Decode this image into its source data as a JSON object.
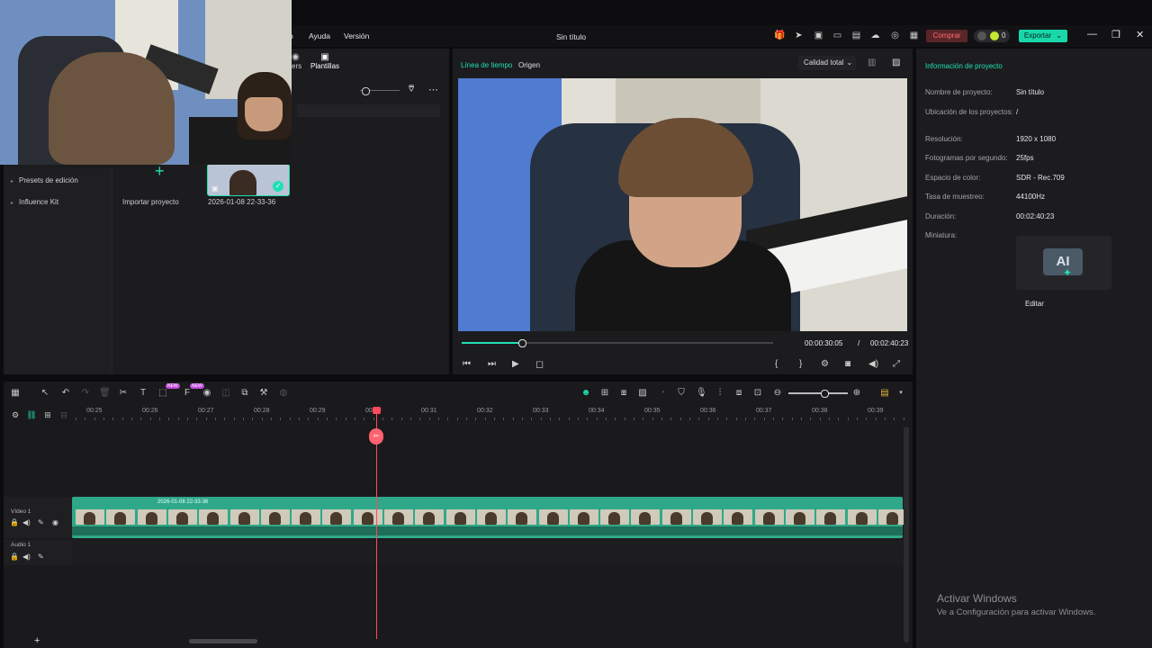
{
  "menu": {
    "help": "Ayuda",
    "version": "Versión",
    "cut_fragment": "o"
  },
  "app_title": "Sin título",
  "top_actions": {
    "buy_label": "Comprar",
    "credits": "0",
    "export_label": "Exportar"
  },
  "media": {
    "tabs": [
      {
        "label": "kers"
      },
      {
        "label": "Plantillas"
      }
    ],
    "sidebar_items": [
      "Presets de edición",
      "Influence Kit"
    ],
    "import_label": "Importar proyecto",
    "clip_name": "2026-01-08 22-33-36"
  },
  "preview": {
    "tabs": [
      {
        "label": "Línea de tiempo"
      },
      {
        "label": "Origen"
      }
    ],
    "quality_label": "Calidad total",
    "current_time": "00:00:30:05",
    "separator": "/",
    "total_time": "00:02:40:23",
    "progress_fraction": 0.195
  },
  "project_info": {
    "title": "Información de proyecto",
    "rows": [
      {
        "label": "Nombre de proyecto:",
        "value": "Sin título"
      },
      {
        "label": "Ubicación de los proyectos:",
        "value": "/"
      },
      {
        "label": "Resolución:",
        "value": "1920 x 1080"
      },
      {
        "label": "Fotogramas por segundo:",
        "value": "25fps"
      },
      {
        "label": "Espacio de color:",
        "value": "SDR - Rec.709"
      },
      {
        "label": "Tasa de muestreo:",
        "value": "44100Hz"
      },
      {
        "label": "Duración:",
        "value": "00:02:40:23"
      },
      {
        "label": "Miniatura:",
        "value": ""
      }
    ],
    "thumbnail_text": "AI",
    "edit_label": "Editar"
  },
  "timeline": {
    "ruler_labels": [
      "00:25",
      "00:26",
      "00:27",
      "00:28",
      "00:29",
      "00:30",
      "00:31",
      "00:32",
      "00:33",
      "00:34",
      "00:35",
      "00:36",
      "00:37",
      "00:38",
      "00:39"
    ],
    "tracks": {
      "video_label": "Vídeo 1",
      "audio_label": "Audio 1"
    },
    "clip_label": "2026-01-08 22-33-36",
    "badge_new": "NEW",
    "add_track": "+"
  },
  "watermark": {
    "title": "Activar Windows",
    "subtitle": "Ve a Configuración para activar Windows."
  },
  "colors": {
    "accent": "#20e0b2",
    "playhead": "#ff4a5a",
    "clip": "#2fa88a"
  }
}
